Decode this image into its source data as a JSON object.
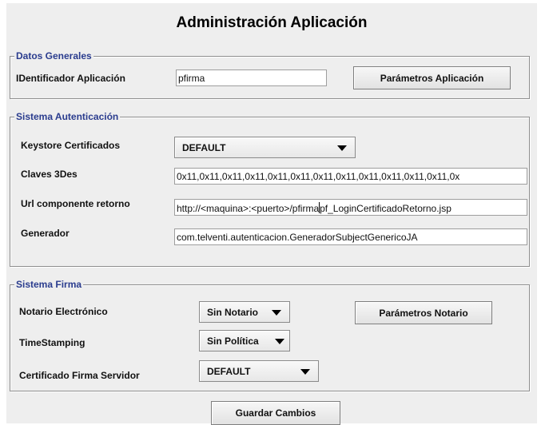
{
  "title": "Administración Aplicación",
  "datos_generales": {
    "legend": "Datos Generales",
    "id_label": "IDentificador Aplicación",
    "id_value": "pfirma",
    "params_button": "Parámetros Aplicación"
  },
  "autenticacion": {
    "legend": "Sistema Autenticación",
    "keystore_label": "Keystore Certificados",
    "keystore_value": "DEFAULT",
    "claves_label": "Claves 3Des",
    "claves_value": "0x11,0x11,0x11,0x11,0x11,0x11,0x11,0x11,0x11,0x11,0x11,0x11,0x",
    "url_label": "Url componente retorno",
    "url_value_before_caret": "http://<maquina>:<puerto>/pfirma",
    "url_value_after_caret": "pf_LoginCertificadoRetorno.jsp",
    "generador_label": "Generador",
    "generador_value": "com.telventi.autenticacion.GeneradorSubjectGenericoJA"
  },
  "firma": {
    "legend": "Sistema Firma",
    "notario_label": "Notario Electrónico",
    "notario_value": "Sin Notario",
    "notario_button": "Parámetros Notario",
    "timestamping_label": "TimeStamping",
    "timestamping_value": "Sin Política",
    "certificado_label": "Certificado Firma Servidor",
    "certificado_value": "DEFAULT"
  },
  "save_button": "Guardar Cambios",
  "icons": {
    "dropdown": "triangle-down-icon"
  }
}
